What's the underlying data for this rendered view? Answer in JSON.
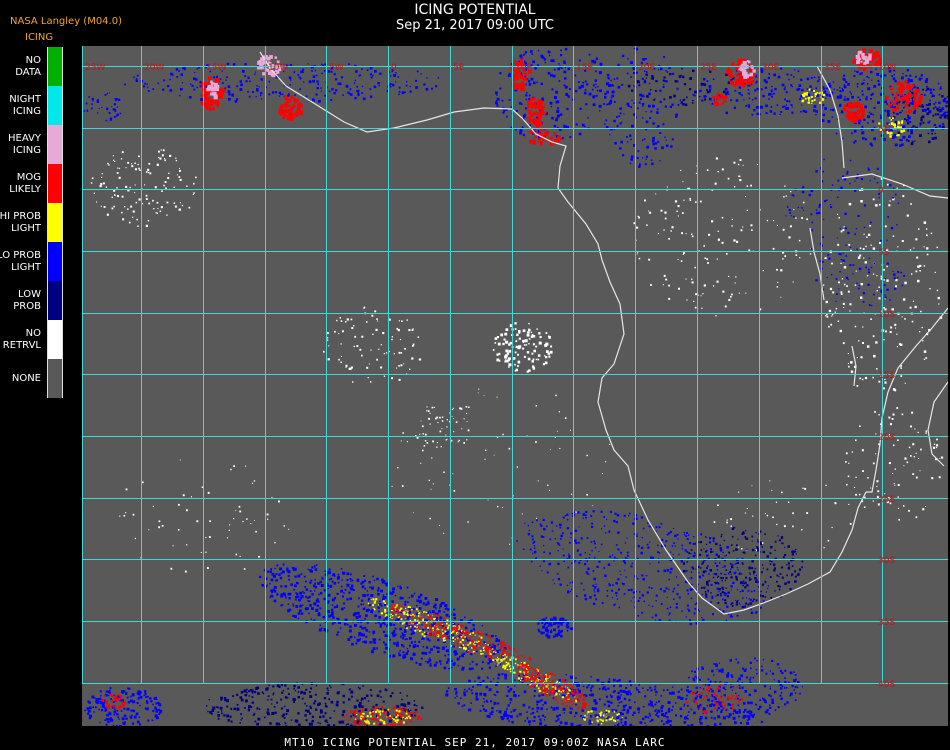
{
  "header": {
    "title": "ICING POTENTIAL",
    "date": "Sep 21, 2017 09:00 UTC",
    "provider": "NASA Langley (M04.0)"
  },
  "legend": {
    "title": "ICING",
    "items": [
      {
        "label": "NO DATA",
        "color": "#00b000"
      },
      {
        "label": "NIGHT ICING",
        "color": "#00e8e8"
      },
      {
        "label": "HEAVY ICING",
        "color": "#e8a8d8"
      },
      {
        "label": "MOG LIKELY",
        "color": "#ff0000"
      },
      {
        "label": "HI PROB LIGHT",
        "color": "#ffff00"
      },
      {
        "label": "LO PROB LIGHT",
        "color": "#0000ff"
      },
      {
        "label": "LOW PROB",
        "color": "#000080"
      },
      {
        "label": "NO RETRVL",
        "color": "#ffffff"
      },
      {
        "label": "NONE",
        "color": "#595959"
      }
    ]
  },
  "map": {
    "background": "#595959",
    "grid_color": "#40d8d8",
    "coast_color": "#e6e6e6",
    "lon_labels": [
      "25W",
      "20W",
      "15W",
      "10W",
      "5W",
      "0",
      "5E",
      "10E",
      "15E",
      "20E",
      "25E",
      "30E",
      "35E"
    ],
    "lat_labels": [
      "10N",
      "5N",
      "0",
      "5S",
      "10S",
      "15S",
      "20S",
      "25S",
      "30S",
      "35S",
      "40S",
      "45S"
    ]
  },
  "footer": {
    "text": "MT10  ICING POTENTIAL   SEP 21, 2017 09:00Z  NASA LARC"
  }
}
